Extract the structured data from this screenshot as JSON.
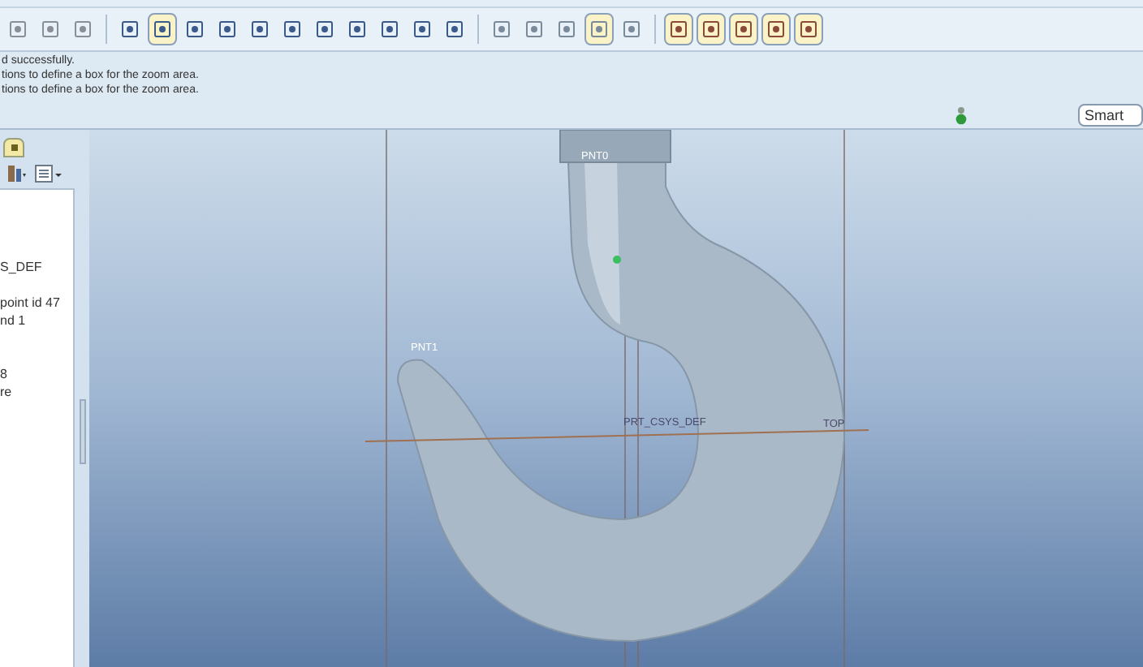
{
  "toolbar_buttons": [
    {
      "pressed": false
    },
    {
      "pressed": false
    },
    {
      "pressed": false
    },
    {
      "pressed": false
    },
    {
      "pressed": true
    },
    {
      "pressed": false
    },
    {
      "pressed": false
    },
    {
      "pressed": false
    },
    {
      "pressed": false
    },
    {
      "pressed": false
    },
    {
      "pressed": false
    },
    {
      "pressed": false
    },
    {
      "pressed": false
    },
    {
      "pressed": false
    },
    {
      "pressed": false
    },
    {
      "pressed": false
    },
    {
      "pressed": false
    },
    {
      "pressed": true
    },
    {
      "pressed": false
    },
    {
      "pressed": true
    },
    {
      "pressed": true
    },
    {
      "pressed": true
    },
    {
      "pressed": true
    },
    {
      "pressed": true
    }
  ],
  "messages": [
    "d successfully.",
    "tions to define a box for the zoom area.",
    "tions to define a box for the zoom area."
  ],
  "filter": {
    "value": "Smart"
  },
  "tree": {
    "items": [
      "S_DEF",
      "point id 47",
      "nd 1",
      "8",
      "re"
    ]
  },
  "viewport": {
    "labels": [
      {
        "kind": "point",
        "text": "PNT0"
      },
      {
        "kind": "point",
        "text": "PNT1"
      },
      {
        "kind": "csys",
        "text": "PRT_CSYS_DEF"
      },
      {
        "kind": "plane",
        "text": "TOP"
      }
    ]
  }
}
